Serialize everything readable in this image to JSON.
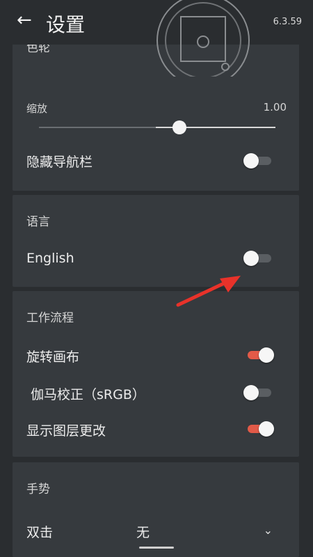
{
  "header": {
    "title": "设置",
    "version": "6.3.59"
  },
  "card1": {
    "section": "色轮",
    "zoom_label": "缩放",
    "zoom_value": "1.00",
    "zoom_fraction": 0.6,
    "hide_nav_label": "隐藏导航栏",
    "hide_nav_on": false
  },
  "language": {
    "section": "语言",
    "english_label": "English",
    "english_on": false
  },
  "workflow": {
    "section": "工作流程",
    "items": [
      {
        "label": "旋转画布",
        "on": true
      },
      {
        "label": "伽马校正（sRGB）",
        "on": false
      },
      {
        "label": "显示图层更改",
        "on": true
      }
    ]
  },
  "gestures": {
    "section": "手势",
    "double_tap_label": "双击",
    "double_tap_value": "无"
  },
  "colors": {
    "accent": "#e25a48",
    "arrow": "#e8322a"
  },
  "icons": {
    "back": "back-arrow-icon",
    "wheel": "color-wheel-icon",
    "dropdown": "chevron-down-icon"
  }
}
